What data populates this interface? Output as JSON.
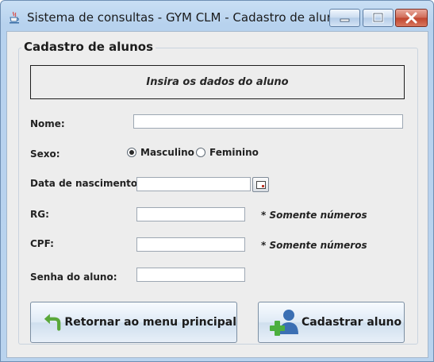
{
  "window": {
    "title": "Sistema de consultas - GYM CLM - Cadastro de alunos",
    "controls": [
      "minimize-icon",
      "maximize-icon",
      "close-icon"
    ]
  },
  "form": {
    "group_title": "Cadastro de alunos",
    "header": "Insira os dados do aluno",
    "name_label": "Nome:",
    "name_value": "",
    "sex_label": "Sexo:",
    "sex_options": [
      "Masculino",
      "Feminino"
    ],
    "sex_selected": "Masculino",
    "birth_label": "Data de nascimento:",
    "birth_value": "",
    "rg_label": "RG:",
    "rg_value": "",
    "rg_note": "* Somente números",
    "cpf_label": "CPF:",
    "cpf_value": "",
    "cpf_note": "* Somente números",
    "password_label": "Senha do aluno:",
    "password_value": ""
  },
  "buttons": {
    "back_label": "Retornar ao menu principal",
    "register_label": "Cadastrar aluno"
  },
  "icons": {
    "back": "return-arrow-icon",
    "register": "add-user-icon",
    "calendar": "calendar-icon",
    "app": "java-cup-icon"
  }
}
